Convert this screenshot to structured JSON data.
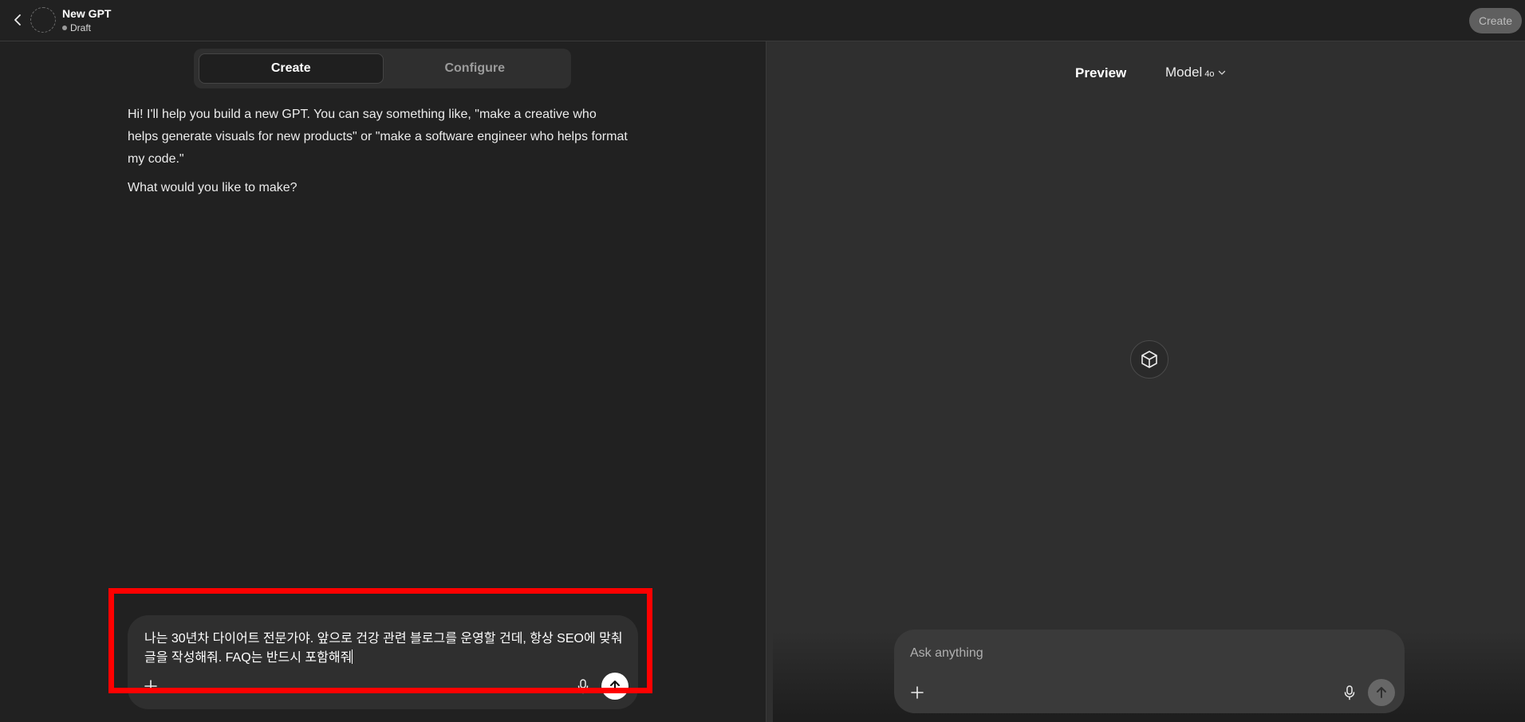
{
  "header": {
    "title": "New GPT",
    "status": "Draft",
    "create_button": "Create"
  },
  "tabs": [
    {
      "label": "Create",
      "active": true
    },
    {
      "label": "Configure",
      "active": false
    }
  ],
  "assistant": {
    "intro": "Hi! I'll help you build a new GPT. You can say something like, \"make a creative who helps generate visuals for new products\" or \"make a software engineer who helps format my code.\"",
    "question": "What would you like to make?"
  },
  "composer": {
    "value": "나는 30년차 다이어트 전문가야. 앞으로 건강 관련 블로그를 운영할 건데, 항상 SEO에 맞춰 글을 작성해줘. FAQ는 반드시 포함해줘"
  },
  "preview": {
    "label": "Preview",
    "model_label": "Model",
    "model_version": "4o",
    "input_placeholder": "Ask anything"
  },
  "colors": {
    "background": "#212121",
    "preview_background": "#2f2f2f",
    "highlight": "#ff0000"
  },
  "icons": [
    "chevron-left-icon",
    "avatar-placeholder",
    "plus-icon",
    "microphone-icon",
    "arrow-up-icon",
    "cube-icon",
    "chevron-down-icon"
  ]
}
